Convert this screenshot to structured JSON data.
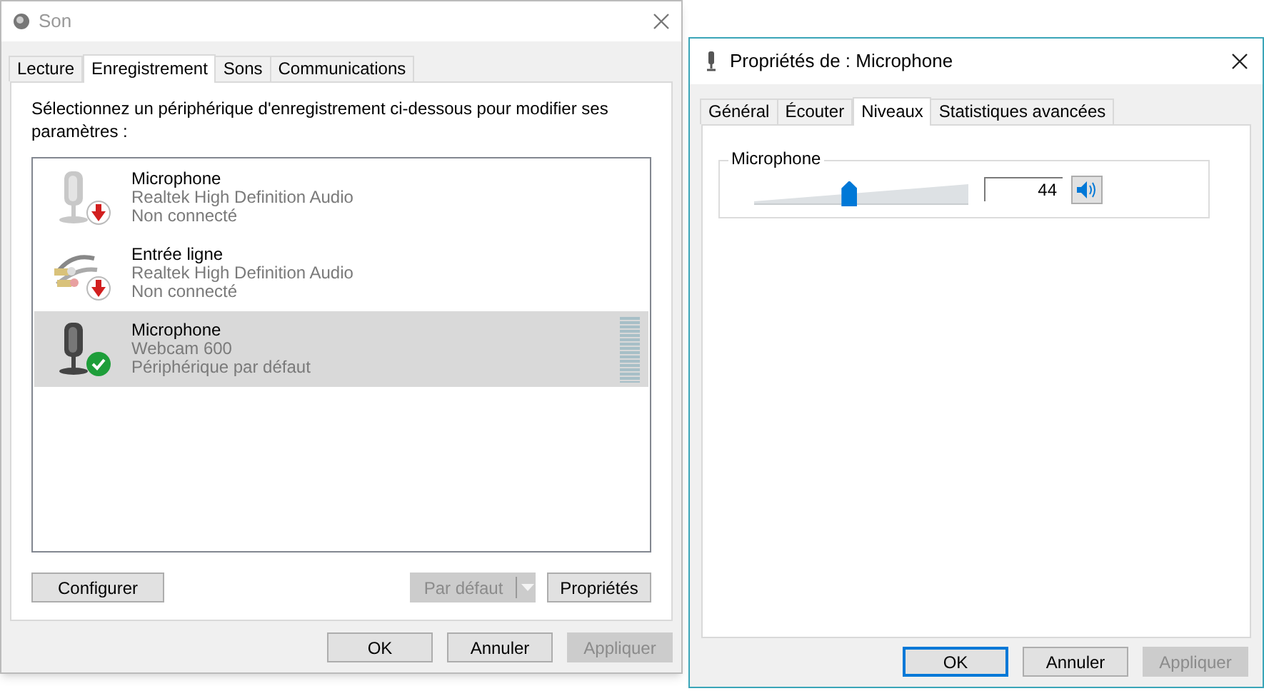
{
  "sound_window": {
    "title": "Son",
    "tabs": [
      {
        "label": "Lecture",
        "selected": false
      },
      {
        "label": "Enregistrement",
        "selected": true
      },
      {
        "label": "Sons",
        "selected": false
      },
      {
        "label": "Communications",
        "selected": false
      }
    ],
    "instruction": "Sélectionnez un périphérique d'enregistrement ci-dessous pour modifier ses paramètres :",
    "devices": [
      {
        "kind": "microphone",
        "name": "Microphone",
        "driver": "Realtek High Definition Audio",
        "status": "Non connecté",
        "connected": false,
        "default": false,
        "selected": false
      },
      {
        "kind": "line-in",
        "name": "Entrée ligne",
        "driver": "Realtek High Definition Audio",
        "status": "Non connecté",
        "connected": false,
        "default": false,
        "selected": false
      },
      {
        "kind": "microphone",
        "name": "Microphone",
        "driver": "Webcam 600",
        "status": "Périphérique par défaut",
        "connected": true,
        "default": true,
        "selected": true
      }
    ],
    "list_buttons": [
      {
        "label": "Configurer",
        "disabled": false,
        "kind": "plain"
      },
      {
        "label": "Par défaut",
        "disabled": true,
        "kind": "split"
      },
      {
        "label": "Propriétés",
        "disabled": false,
        "kind": "plain"
      }
    ],
    "buttons": [
      {
        "label": "OK",
        "disabled": false,
        "focused": false
      },
      {
        "label": "Annuler",
        "disabled": false,
        "focused": false
      },
      {
        "label": "Appliquer",
        "disabled": true,
        "focused": false
      }
    ]
  },
  "properties_window": {
    "title": "Propriétés de : Microphone",
    "tabs": [
      {
        "label": "Général",
        "selected": false
      },
      {
        "label": "Écouter",
        "selected": false
      },
      {
        "label": "Niveaux",
        "selected": true
      },
      {
        "label": "Statistiques avancées",
        "selected": false
      }
    ],
    "level_group": {
      "label": "Microphone",
      "level": 0.44,
      "value": "44",
      "muted": false
    },
    "buttons": [
      {
        "label": "OK",
        "disabled": false,
        "focused": true
      },
      {
        "label": "Annuler",
        "disabled": false,
        "focused": false
      },
      {
        "label": "Appliquer",
        "disabled": true,
        "focused": false
      }
    ]
  }
}
